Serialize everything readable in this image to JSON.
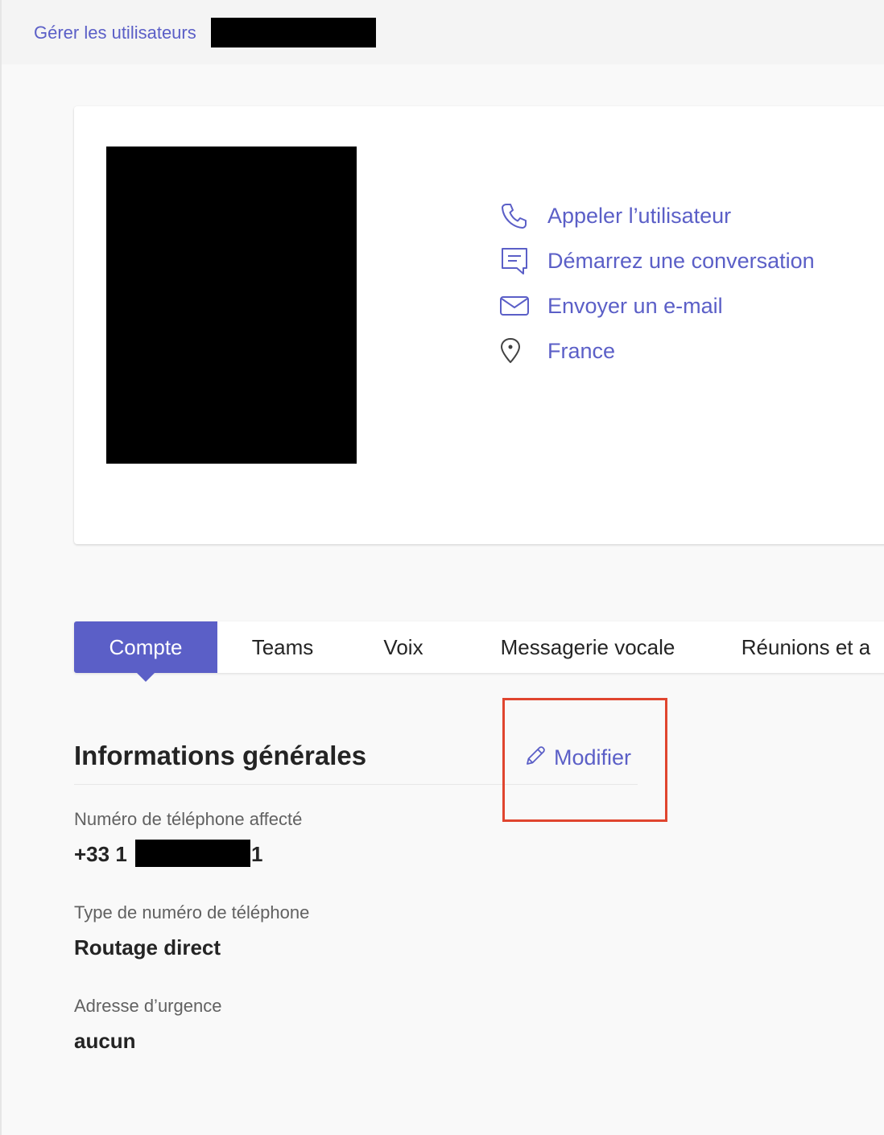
{
  "breadcrumb": {
    "link_label": "Gérer les utilisateurs"
  },
  "profile": {
    "actions": [
      {
        "label": "Appeler l’utilisateur",
        "icon": "phone-icon"
      },
      {
        "label": "Démarrez une conversation",
        "icon": "chat-icon"
      },
      {
        "label": "Envoyer un e-mail",
        "icon": "mail-icon"
      },
      {
        "label": "France",
        "icon": "location-pin-icon"
      }
    ]
  },
  "tabs": [
    {
      "label": "Compte",
      "active": true
    },
    {
      "label": "Teams",
      "active": false
    },
    {
      "label": "Voix",
      "active": false
    },
    {
      "label": "Messagerie vocale",
      "active": false
    },
    {
      "label": "Réunions et a",
      "active": false
    }
  ],
  "general_info": {
    "title": "Informations générales",
    "edit_label": "Modifier",
    "fields": [
      {
        "label": "Numéro de téléphone affecté",
        "value_prefix": "+33 1",
        "value_suffix": "1"
      },
      {
        "label": "Type de numéro de téléphone",
        "value": "Routage direct"
      },
      {
        "label": "Adresse d’urgence",
        "value": "aucun"
      }
    ]
  },
  "colors": {
    "accent": "#5b5fc7",
    "highlight": "#e0452f",
    "text": "#242424",
    "muted": "#616161"
  }
}
